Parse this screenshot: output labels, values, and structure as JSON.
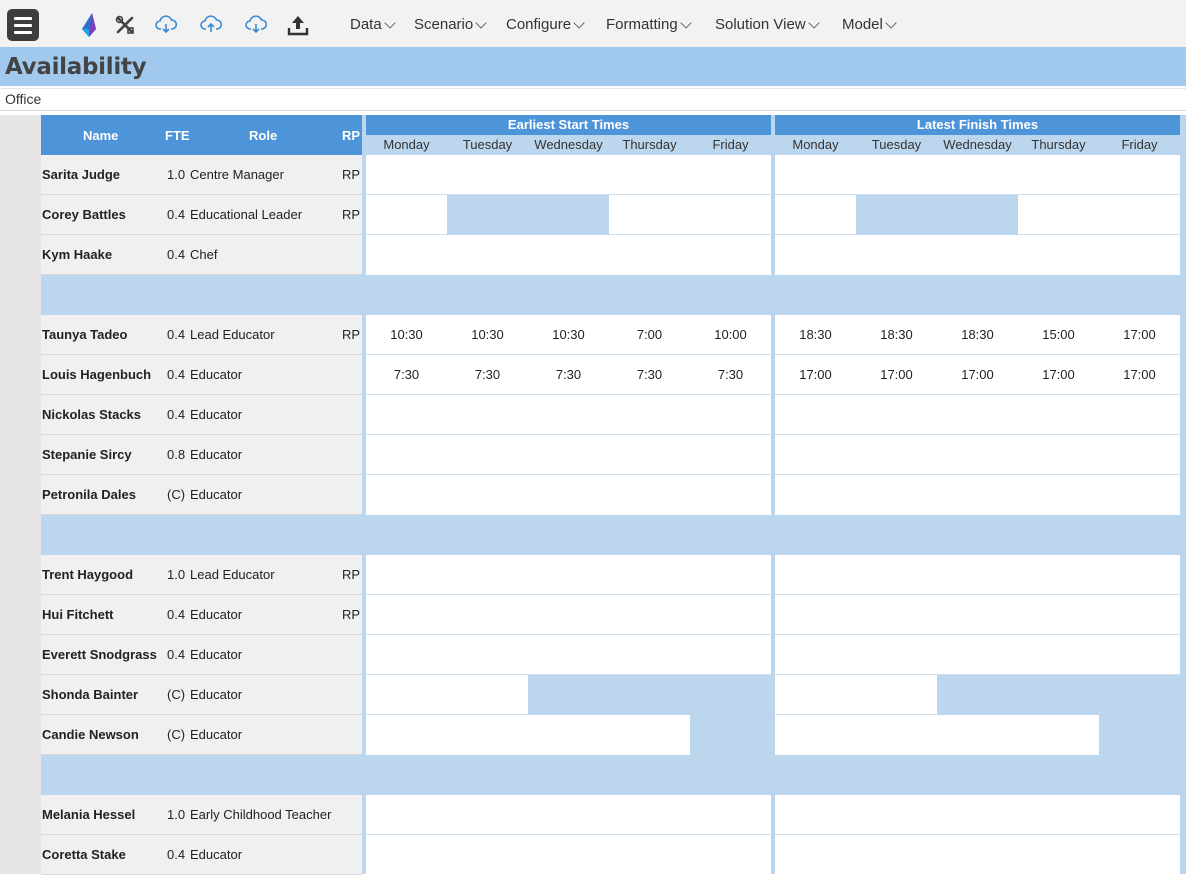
{
  "toolbar": {
    "menu_icon": "hamburger-menu-icon",
    "icons": [
      "app-logo-icon",
      "tools-icon",
      "cloud-download-icon",
      "cloud-upload-icon",
      "cloud-refresh-icon",
      "export-upload-icon"
    ],
    "menus": [
      "Data",
      "Scenario",
      "Configure",
      "Formatting",
      "Solution View",
      "Model"
    ]
  },
  "page": {
    "title": "Availability",
    "location": "Office"
  },
  "colors": {
    "header_blue": "#4e94d8",
    "title_blue": "#a1c9ee",
    "light_blue": "#bcd6ee",
    "unavailable_blue": "#bcd6ee"
  },
  "table": {
    "columns": {
      "name": "Name",
      "fte": "FTE",
      "role": "Role",
      "rp": "RP"
    },
    "groups": [
      "Earliest Start Times",
      "Latest Finish Times"
    ],
    "days": [
      "Monday",
      "Tuesday",
      "Wednesday",
      "Thursday",
      "Friday"
    ],
    "sections": [
      [
        {
          "name": "Sarita Judge",
          "fte": "1.0",
          "role": "Centre Manager",
          "rp": "RP",
          "start": [
            "",
            "",
            "",
            "",
            ""
          ],
          "finish": [
            "",
            "",
            "",
            "",
            ""
          ],
          "unavailable": []
        },
        {
          "name": "Corey Battles",
          "fte": "0.4",
          "role": "Educational Leader",
          "rp": "RP",
          "start": [
            "",
            "",
            "",
            "",
            ""
          ],
          "finish": [
            "",
            "",
            "",
            "",
            ""
          ],
          "unavailable": [
            "Tuesday",
            "Wednesday"
          ]
        },
        {
          "name": "Kym Haake",
          "fte": "0.4",
          "role": "Chef",
          "rp": "",
          "start": [
            "",
            "",
            "",
            "",
            ""
          ],
          "finish": [
            "",
            "",
            "",
            "",
            ""
          ],
          "unavailable": []
        }
      ],
      [
        {
          "name": "Taunya Tadeo",
          "fte": "0.4",
          "role": "Lead Educator",
          "rp": "RP",
          "start": [
            "10:30",
            "10:30",
            "10:30",
            "7:00",
            "10:00"
          ],
          "finish": [
            "18:30",
            "18:30",
            "18:30",
            "15:00",
            "17:00"
          ],
          "unavailable": []
        },
        {
          "name": "Louis Hagenbuch",
          "fte": "0.4",
          "role": "Educator",
          "rp": "",
          "start": [
            "7:30",
            "7:30",
            "7:30",
            "7:30",
            "7:30"
          ],
          "finish": [
            "17:00",
            "17:00",
            "17:00",
            "17:00",
            "17:00"
          ],
          "unavailable": []
        },
        {
          "name": "Nickolas Stacks",
          "fte": "0.4",
          "role": "Educator",
          "rp": "",
          "start": [
            "",
            "",
            "",
            "",
            ""
          ],
          "finish": [
            "",
            "",
            "",
            "",
            ""
          ],
          "unavailable": []
        },
        {
          "name": "Stepanie Sircy",
          "fte": "0.8",
          "role": "Educator",
          "rp": "",
          "start": [
            "",
            "",
            "",
            "",
            ""
          ],
          "finish": [
            "",
            "",
            "",
            "",
            ""
          ],
          "unavailable": []
        },
        {
          "name": "Petronila Dales",
          "fte": "(C)",
          "role": "Educator",
          "rp": "",
          "start": [
            "",
            "",
            "",
            "",
            ""
          ],
          "finish": [
            "",
            "",
            "",
            "",
            ""
          ],
          "unavailable": []
        }
      ],
      [
        {
          "name": "Trent Haygood",
          "fte": "1.0",
          "role": "Lead Educator",
          "rp": "RP",
          "start": [
            "",
            "",
            "",
            "",
            ""
          ],
          "finish": [
            "",
            "",
            "",
            "",
            ""
          ],
          "unavailable": []
        },
        {
          "name": "Hui Fitchett",
          "fte": "0.4",
          "role": "Educator",
          "rp": "RP",
          "start": [
            "",
            "",
            "",
            "",
            ""
          ],
          "finish": [
            "",
            "",
            "",
            "",
            ""
          ],
          "unavailable": []
        },
        {
          "name": "Everett Snodgrass",
          "fte": "0.4",
          "role": "Educator",
          "rp": "",
          "start": [
            "",
            "",
            "",
            "",
            ""
          ],
          "finish": [
            "",
            "",
            "",
            "",
            ""
          ],
          "unavailable": []
        },
        {
          "name": "Shonda Bainter",
          "fte": "(C)",
          "role": "Educator",
          "rp": "",
          "start": [
            "",
            "",
            "",
            "",
            ""
          ],
          "finish": [
            "",
            "",
            "",
            "",
            ""
          ],
          "unavailable": [
            "Wednesday",
            "Thursday",
            "Friday"
          ]
        },
        {
          "name": "Candie Newson",
          "fte": "(C)",
          "role": "Educator",
          "rp": "",
          "start": [
            "",
            "",
            "",
            "",
            ""
          ],
          "finish": [
            "",
            "",
            "",
            "",
            ""
          ],
          "unavailable": [
            "Friday"
          ]
        }
      ],
      [
        {
          "name": "Melania Hessel",
          "fte": "1.0",
          "role": "Early Childhood Teacher",
          "rp": "",
          "start": [
            "",
            "",
            "",
            "",
            ""
          ],
          "finish": [
            "",
            "",
            "",
            "",
            ""
          ],
          "unavailable": []
        },
        {
          "name": "Coretta Stake",
          "fte": "0.4",
          "role": "Educator",
          "rp": "",
          "start": [
            "",
            "",
            "",
            "",
            ""
          ],
          "finish": [
            "",
            "",
            "",
            "",
            ""
          ],
          "unavailable": []
        }
      ]
    ]
  }
}
